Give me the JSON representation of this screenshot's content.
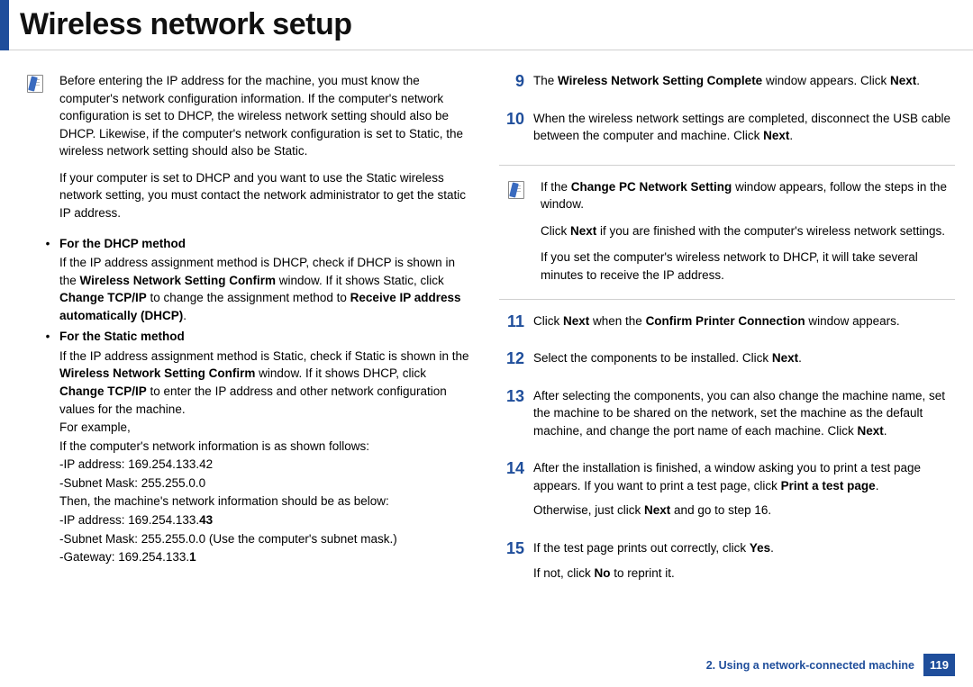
{
  "title": "Wireless network setup",
  "left": {
    "note1": "Before entering the IP address for the machine, you must know the computer's network configuration information. If the computer's network configuration is set to DHCP, the wireless network setting should also be DHCP. Likewise, if the computer's network configuration is set to Static, the wireless network setting should also be Static.",
    "note2": "If your computer is set to DHCP and you want to use the Static wireless network setting, you must contact the network administrator to get the static IP address.",
    "dhcp": {
      "head": "For the DHCP method",
      "p1a": "If the IP address assignment method is DHCP, check if DHCP is shown in the ",
      "p1b": "Wireless Network Setting Confirm",
      "p1c": " window. If it shows Static, click ",
      "p1d": "Change TCP/IP",
      "p1e": " to change the assignment method to ",
      "p1f": "Receive IP address automatically (DHCP)",
      "p1g": "."
    },
    "static": {
      "head": "For the Static method",
      "p1a": "If the IP address assignment method is Static, check if Static is shown in the ",
      "p1b": "Wireless Network Setting Confirm",
      "p1c": " window. If it shows DHCP, click ",
      "p1d": "Change TCP/IP",
      "p1e": " to enter the IP address and other network configuration values for the machine.",
      "ex": "For example,",
      "l1": "If the computer's network information is as shown follows:",
      "l2": "-IP address: 169.254.133.42",
      "l3": "-Subnet Mask: 255.255.0.0",
      "l4": "Then, the machine's network information should be as below:",
      "l5a": "-IP address: 169.254.133.",
      "l5b": "43",
      "l6": "-Subnet Mask: 255.255.0.0 (Use the computer's subnet mask.)",
      "l7a": "-Gateway: 169.254.133.",
      "l7b": "1"
    }
  },
  "right": {
    "s9n": "9",
    "s9a": "The ",
    "s9b": "Wireless Network Setting Complete",
    "s9c": " window appears. Click ",
    "s9d": "Next",
    "s9e": ".",
    "s10n": "10",
    "s10a": "When the wireless network settings are completed, disconnect the USB cable between the computer and machine. Click ",
    "s10b": "Next",
    "s10c": ".",
    "n1a": "If the ",
    "n1b": "Change PC Network Setting",
    "n1c": " window appears, follow the steps in the window.",
    "n2a": "Click ",
    "n2b": "Next",
    "n2c": " if you are finished with the computer's wireless network settings.",
    "n3": "If you set the computer's wireless network to DHCP, it will take several minutes to receive the IP address.",
    "s11n": "11",
    "s11a": "Click ",
    "s11b": "Next",
    "s11c": " when the ",
    "s11d": "Confirm Printer Connection",
    "s11e": " window appears.",
    "s12n": "12",
    "s12a": "Select the components to be installed. Click ",
    "s12b": "Next",
    "s12c": ".",
    "s13n": "13",
    "s13a": "After selecting the components, you can also change the machine name, set the machine to be shared on the network, set the machine as the default machine, and change the port name of each machine. Click ",
    "s13b": "Next",
    "s13c": ".",
    "s14n": "14",
    "s14a": "After the installation is finished, a window asking you to print a test page appears. If you want to print a test page, click ",
    "s14b": "Print a test page",
    "s14c": ".",
    "s14d": "Otherwise, just click ",
    "s14e": "Next",
    "s14f": " and go to step 16.",
    "s15n": "15",
    "s15a": "If the test page prints out correctly, click ",
    "s15b": "Yes",
    "s15c": ".",
    "s15d": "If not, click ",
    "s15e": "No",
    "s15f": " to reprint it."
  },
  "footer": {
    "chapter": "2.  Using a network-connected machine",
    "page": "119"
  }
}
